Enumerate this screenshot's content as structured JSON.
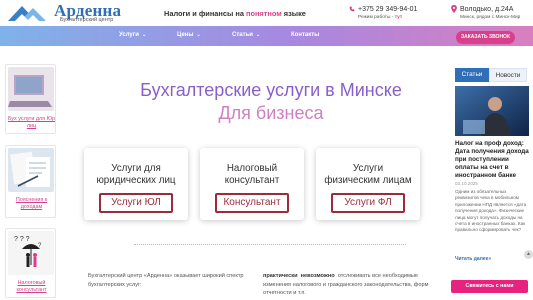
{
  "header": {
    "logo_title": "Арденна",
    "logo_subtitle": "Бухгалтерский центр",
    "slogan_pre": "Налоги и финансы на ",
    "slogan_highlight": "понятном",
    "slogan_post": " языке",
    "phone": "+375 29 349-94-01",
    "hours_label": "Режим работы - ",
    "hours_link": "тут",
    "address": "Володько, д.24А",
    "address_sub": "Минск, рядом с Минск-Мир"
  },
  "nav": {
    "items": [
      {
        "label": "Услуги"
      },
      {
        "label": "Цены"
      },
      {
        "label": "Статьи"
      },
      {
        "label": "Контакты"
      }
    ],
    "callback_label": "ЗАКАЗАТЬ ЗВОНОК"
  },
  "left_sidebar": {
    "cards": [
      {
        "label": "Бух услуги для Юр лиц"
      },
      {
        "label": "Пояснения к доходам"
      },
      {
        "label": "Налоговый консультант"
      }
    ]
  },
  "hero": {
    "title": "Бухгалтерские услуги в Минске",
    "subtitle": "Для бизнеса"
  },
  "services": [
    {
      "title_line1": "Услуги для",
      "title_line2": "юридических лиц",
      "button": "Услуги ЮЛ"
    },
    {
      "title_line1": "Налоговый",
      "title_line2": "консультант",
      "button": "Консультант"
    },
    {
      "title_line1": "Услуги",
      "title_line2": "физическим лицам",
      "button": "Услуги ФЛ"
    }
  ],
  "intro": {
    "left_text": "Бухгалтерский центр «Арденна» оказывает широкий спектр бухгалтерских услуг:",
    "right_bold_1": "практически",
    "right_bold_2": "невозможно",
    "right_text_1": "отслеживать все",
    "right_text_2": "необходимые изменения налогового и гражданского законодательства, форм отчетности и т.п."
  },
  "right_sidebar": {
    "tab_active": "Статьи",
    "tab_inactive": "Новости",
    "news_title": "Налог на проф доход: Дата получения дохода при поступлении оплаты на счет в иностранном банке",
    "news_date": "03.10.2025",
    "news_text": "Одним из обязательных реквизитов чека в мобильном приложении НПД является «дата получения дохода». Физические лица могут получать доходы на счета в иностранных банках. Как правильно сформировать чек?",
    "read_more": "Читать далее»",
    "contact_label": "Свяжитесь с нами"
  },
  "colors": {
    "brand_blue": "#2f6fb7",
    "accent_pink": "#d93f8a",
    "button_maroon": "#9b2d3a"
  }
}
